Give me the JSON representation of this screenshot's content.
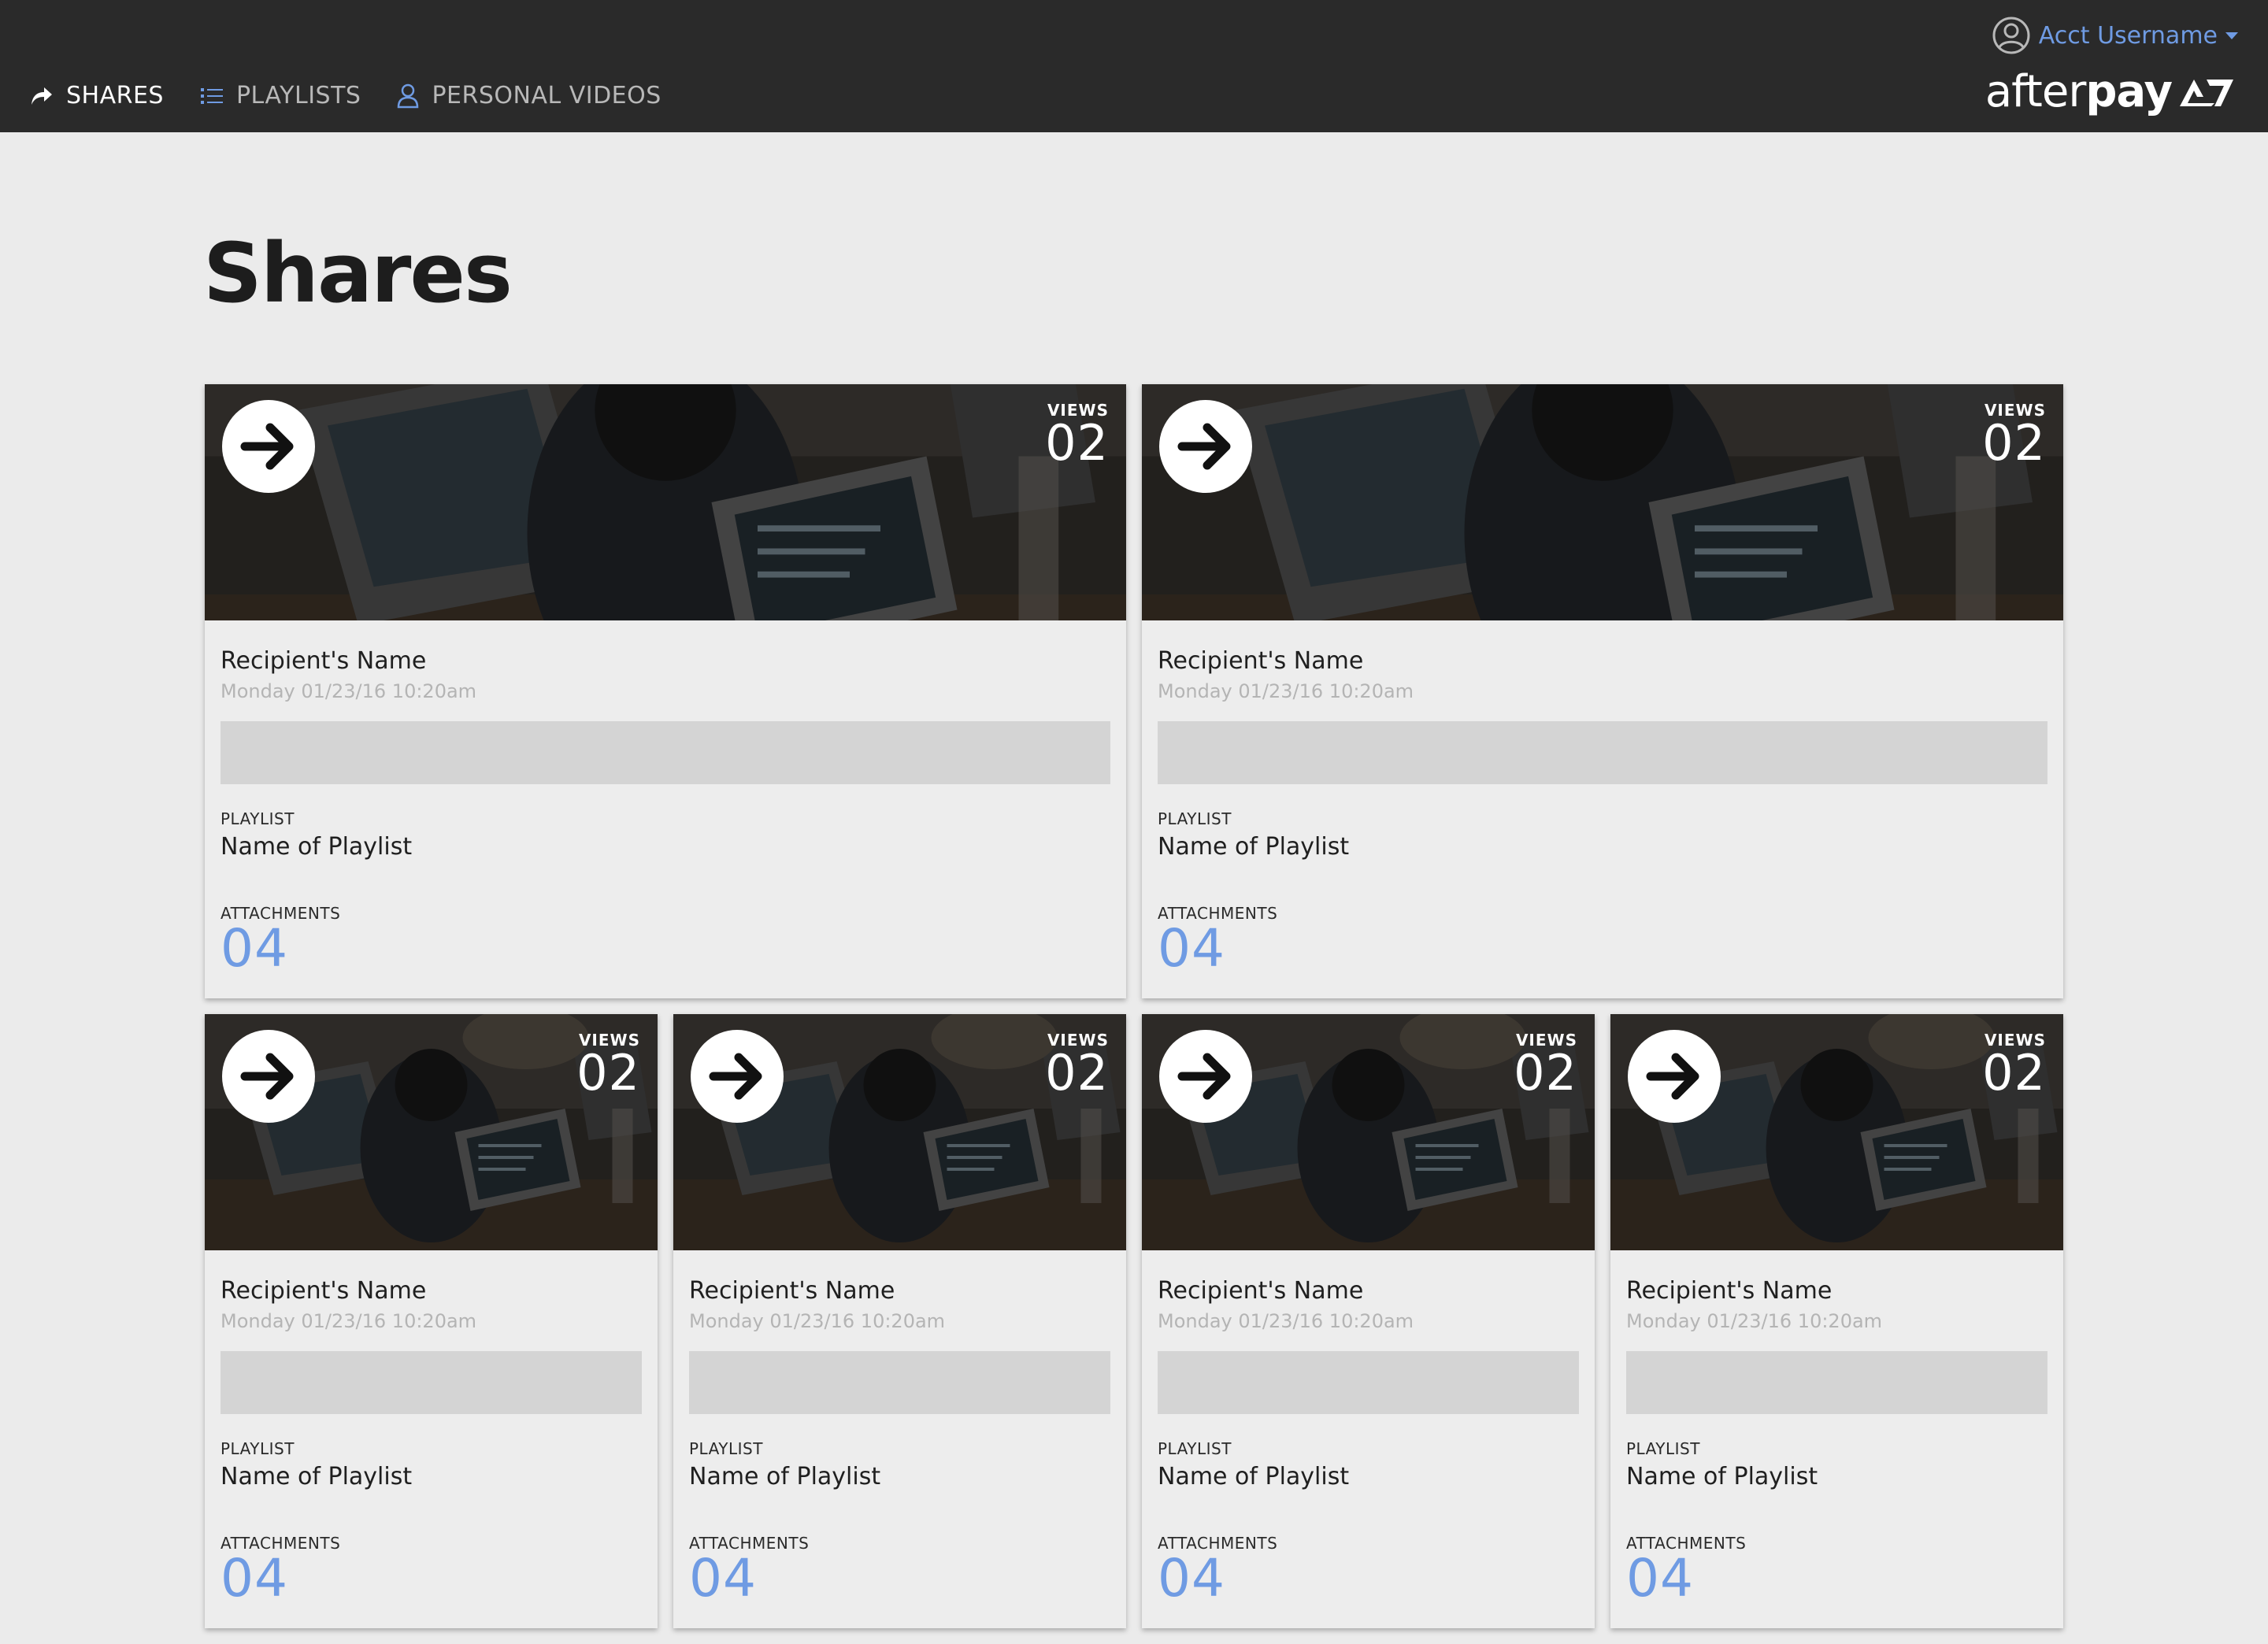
{
  "nav": {
    "items": [
      {
        "label": "SHARES",
        "icon": "share-icon",
        "active": true
      },
      {
        "label": "PLAYLISTS",
        "icon": "list-icon",
        "active": false
      },
      {
        "label": "PERSONAL VIDEOS",
        "icon": "user-icon",
        "active": false
      }
    ]
  },
  "account": {
    "username": "Acct Username",
    "icon": "account-circle-icon"
  },
  "logo": {
    "text_light": "after",
    "text_bold": "pay"
  },
  "page": {
    "title": "Shares"
  },
  "colors": {
    "topbar": "#2a2a2a",
    "accent": "#6f9be3",
    "background": "#ebebeb"
  },
  "cards": [
    {
      "views_label": "VIEWS",
      "views": "02",
      "recipient": "Recipient's Name",
      "date": "Monday 01/23/16 10:20am",
      "playlist_label": "PLAYLIST",
      "playlist": "Name of Playlist",
      "attachments_label": "ATTACHMENTS",
      "attachments": "04"
    },
    {
      "views_label": "VIEWS",
      "views": "02",
      "recipient": "Recipient's Name",
      "date": "Monday 01/23/16 10:20am",
      "playlist_label": "PLAYLIST",
      "playlist": "Name of Playlist",
      "attachments_label": "ATTACHMENTS",
      "attachments": "04"
    },
    {
      "views_label": "VIEWS",
      "views": "02",
      "recipient": "Recipient's Name",
      "date": "Monday 01/23/16 10:20am",
      "playlist_label": "PLAYLIST",
      "playlist": "Name of Playlist",
      "attachments_label": "ATTACHMENTS",
      "attachments": "04"
    },
    {
      "views_label": "VIEWS",
      "views": "02",
      "recipient": "Recipient's Name",
      "date": "Monday 01/23/16 10:20am",
      "playlist_label": "PLAYLIST",
      "playlist": "Name of Playlist",
      "attachments_label": "ATTACHMENTS",
      "attachments": "04"
    },
    {
      "views_label": "VIEWS",
      "views": "02",
      "recipient": "Recipient's Name",
      "date": "Monday 01/23/16 10:20am",
      "playlist_label": "PLAYLIST",
      "playlist": "Name of Playlist",
      "attachments_label": "ATTACHMENTS",
      "attachments": "04"
    },
    {
      "views_label": "VIEWS",
      "views": "02",
      "recipient": "Recipient's Name",
      "date": "Monday 01/23/16 10:20am",
      "playlist_label": "PLAYLIST",
      "playlist": "Name of Playlist",
      "attachments_label": "ATTACHMENTS",
      "attachments": "04"
    }
  ]
}
